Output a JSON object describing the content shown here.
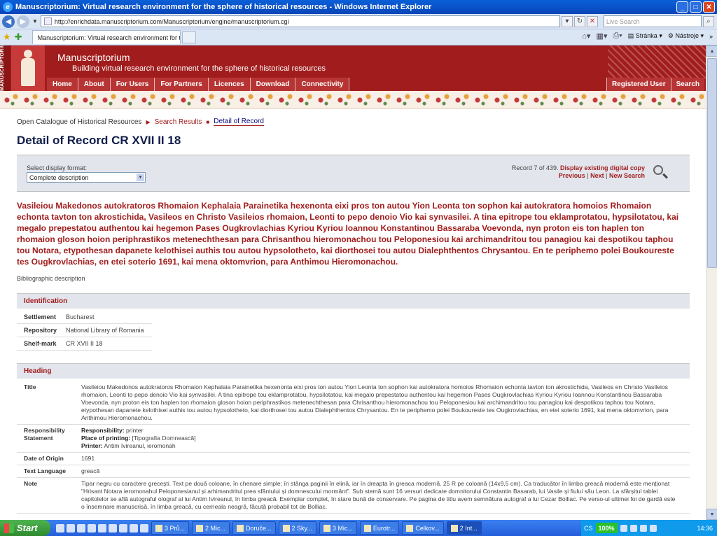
{
  "window": {
    "title": "Manuscriptorium: Virtual research environment for the sphere of historical resources - Windows Internet Explorer"
  },
  "browser": {
    "url": "http://enrichdata.manuscriptorium.com/Manuscriptorium/engine/manuscriptorium.cgi",
    "search_placeholder": "Live Search",
    "tab_title": "Manuscriptorium: Virtual research environment for the...",
    "page_menu": "Stránka",
    "tools_menu": "Nástroje"
  },
  "site": {
    "vertical_logo": "MANUSCRIPTORIUM",
    "title": "Manuscriptorium",
    "subtitle": "Building virtual research environment for the sphere of historical resources",
    "nav": [
      "Home",
      "About",
      "For Users",
      "For Partners",
      "Licences",
      "Download",
      "Connectivity"
    ],
    "nav_right": [
      "Registered User",
      "Search"
    ]
  },
  "breadcrumb": [
    "Open Catalogue of Historical Resources",
    "Search Results",
    "Detail of Record"
  ],
  "page_title": "Detail of Record CR XVII II 18",
  "display_format": {
    "label": "Select display format:",
    "selected": "Complete description"
  },
  "record_nav": {
    "position": "Record 7 of 439.",
    "digital_copy": "Display existing digital copy",
    "previous": "Previous",
    "next": "Next",
    "new_search": "New Search"
  },
  "record_heading": "Vasileiou Makedonos autokratoros Rhomaion Kephalaia Parainetika hexenonta eixi pros ton autou Yion Leonta ton sophon kai autokratora homoios Rhomaion echonta tavton ton akrostichida, Vasileos en Christo Vasileios rhomaion, Leonti to pepo denoio Vio kai synvasilei. A tina epitrope tou eklamprotatou, hypsilotatou, kai megalo prepestatou authentou kai hegemon Pases Ougkrovlachias Kyriou Kyriou Ioannou Konstantinou Bassaraba Voevonda, nyn proton eis ton haplen ton rhomaion gloson hoion periphrastikos metenechthesan para Chrisanthou hieromonachou tou Peloponesiou kai archimandritou tou panagiou kai despotikou taphou tou Notara, etypothesan dapanete kelothisei authis tou autou hypsolotheto, kai diorthosei tou autou Dialephthentos Chrysantou. En te periphemo polei Boukoureste tes Ougkrovlachias, en etei soterio 1691, kai mena oktomvrion, para Anthimou Hieromonachou.",
  "bib_label": "Bibliographic description",
  "identification": {
    "heading": "Identification",
    "rows": [
      {
        "k": "Settlement",
        "v": "Bucharest"
      },
      {
        "k": "Repository",
        "v": "National Library of Romania"
      },
      {
        "k": "Shelf-mark",
        "v": "CR XVII II 18"
      }
    ]
  },
  "heading_section": {
    "heading": "Heading",
    "title_label": "Title",
    "title_value": "Vasileiou Makedonos autokratoros Rhomaion Kephalaia Parainetika hexenonta eixi pros ton autou Yion Leonta ton sophon kai autokratora homoios Rhomaion echonta tavton ton akrostichida, Vasileos en Christo Vasileios rhomaion, Leonti to pepo denoio Vio kai synvasilei. A tina epitrope tou eklamprotatou, hypsilotatou, kai megalo prepestatou authentou kai hegemon Pases Ougkrovlachias Kyriou Kyriou Ioannou Konstantinou Bassaraba Voevonda, nyn proton eis ton haplen ton rhomaion gloson hoion periphrastikos metenechthesan para Chrisanthou hieromonachou tou Peloponesiou kai archimandritou tou panagiou kai despotikou taphou tou Notara, etypothesan dapanete kelothisei authis tou autou hypsolotheto, kai diorthosei tou autou Dialephthentos Chrysantou. En te periphemo polei Boukoureste tes Ougkrovlachias, en etei soterio 1691, kai mena oktomvrion, para Anthimou Hieromonachou.",
    "resp_label": "Responsibility Statement",
    "resp_lines": [
      {
        "k": "Responsibility:",
        "v": " printer"
      },
      {
        "k": "Place of printing:",
        "v": " [Tipografia Domnească]"
      },
      {
        "k": "Printer:",
        "v": " Antim Ivireanul, ieromonah"
      }
    ],
    "date_label": "Date of Origin",
    "date_value": "1691",
    "lang_label": "Text Language",
    "lang_value": "greacă",
    "note_label": "Note",
    "note_value": "Tipar negru cu caractere grecești. Text pe două coloane, în chenare simple; în stânga paginii în elină, iar în dreapta în greaca modernă. 25 R pe coloană (14x9,5 cm). Ca traducător în limba greacă modernă este menționat \"Hrisant Notara ieromonahul Peloponesianul și arhimandritul prea sfântului și domnescului mormânt\". Sub stemă sunt 16 versuri dedicate domnitorului Constantin Basarab, lui Vasile și fiului său Leon. La sfârșitul tablei capitolelor se află autograful olograf al lui Antim Ivireanul, în limba greacă. Exemplar complet, în stare bună de conservare. Pe pagina de titlu avem semnătura autograf a lui Cezar Bolliac. Pe verso-ul ultimei foi de gardă este o însemnare manuscrisă, în limba greacă, cu cerneala neagră, făcută probabil tot de Bolliac."
  },
  "taskbar": {
    "start": "Start",
    "tasks": [
      "3 Prů...",
      "2 Mic...",
      "Doruče...",
      "2 Sky...",
      "3 Mic...",
      "Eurotr...",
      "Celkov...",
      "2 Int..."
    ],
    "lang": "CS",
    "zoom": "100%",
    "clock": "14:36"
  }
}
